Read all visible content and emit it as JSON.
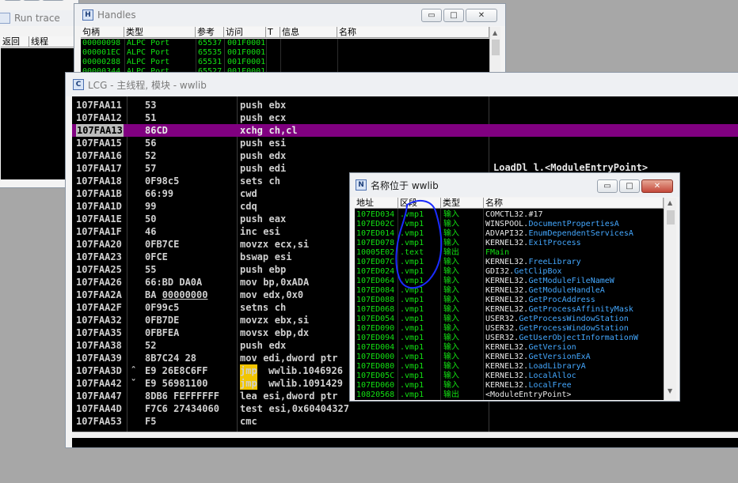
{
  "windows": {
    "run_trace": {
      "title": "Run trace",
      "headers": [
        "返回",
        "线程"
      ]
    },
    "handles": {
      "title": "Handles",
      "headers": [
        "句柄",
        "类型",
        "参考",
        "访问",
        "T",
        "信息",
        "名称"
      ],
      "rows": [
        {
          "handle": "00000098",
          "type": "ALPC Port",
          "ref": "65537",
          "access": "001F0001"
        },
        {
          "handle": "000001EC",
          "type": "ALPC Port",
          "ref": "65535",
          "access": "001F0001"
        },
        {
          "handle": "00000288",
          "type": "ALPC Port",
          "ref": "65531",
          "access": "001F0001"
        },
        {
          "handle": "00000344",
          "type": "ALPC Port",
          "ref": "65527",
          "access": "001F0001"
        }
      ]
    },
    "cpu": {
      "title": "LCG - 主线程, 模块 - wwlib",
      "side_text": "LoadDl l.<ModuleEntryPoint>",
      "rows": [
        {
          "addr": "107FAA11",
          "prefix": "",
          "hex": "53",
          "mn": "push",
          "op": "ebx",
          "style": "push"
        },
        {
          "addr": "107FAA12",
          "prefix": "",
          "hex": "51",
          "mn": "push",
          "op": "ecx",
          "style": "push"
        },
        {
          "addr": "107FAA13",
          "prefix": "",
          "hex": "86CD",
          "mn": "xchg",
          "op": "ch,cl",
          "style": "sel"
        },
        {
          "addr": "107FAA15",
          "prefix": "",
          "hex": "56",
          "mn": "push",
          "op": "esi",
          "style": "push"
        },
        {
          "addr": "107FAA16",
          "prefix": "",
          "hex": "52",
          "mn": "push",
          "op": "edx",
          "style": "push"
        },
        {
          "addr": "107FAA17",
          "prefix": "",
          "hex": "57",
          "mn": "push",
          "op": "edi",
          "style": "push"
        },
        {
          "addr": "107FAA18",
          "prefix": "",
          "hex": "0F98c5",
          "mn": "sets",
          "op": "ch",
          "style": "normal"
        },
        {
          "addr": "107FAA1B",
          "prefix": "",
          "hex": "66:99",
          "mn": "cwd",
          "op": "",
          "style": "normal"
        },
        {
          "addr": "107FAA1D",
          "prefix": "",
          "hex": "99",
          "mn": "cdq",
          "op": "",
          "style": "normal"
        },
        {
          "addr": "107FAA1E",
          "prefix": "",
          "hex": "50",
          "mn": "push",
          "op": "eax",
          "style": "push"
        },
        {
          "addr": "107FAA1F",
          "prefix": "",
          "hex": "46",
          "mn": "inc",
          "op": "esi",
          "style": "normal"
        },
        {
          "addr": "107FAA20",
          "prefix": "",
          "hex": "0FB7CE",
          "mn": "movzx",
          "op": "ecx,si",
          "style": "normal"
        },
        {
          "addr": "107FAA23",
          "prefix": "",
          "hex": "0FCE",
          "mn": "bswap",
          "op": "esi",
          "style": "normal"
        },
        {
          "addr": "107FAA25",
          "prefix": "",
          "hex": "55",
          "mn": "push",
          "op": "ebp",
          "style": "push"
        },
        {
          "addr": "107FAA26",
          "prefix": "",
          "hex": "66:BD DA0A",
          "mn": "mov",
          "op": "bp,",
          "imm": "0xADA",
          "style": "normal"
        },
        {
          "addr": "107FAA2A",
          "prefix": "",
          "hex": "BA 00000000",
          "mn": "mov",
          "op": "edx,",
          "imm": "0x0",
          "style": "normal"
        },
        {
          "addr": "107FAA2F",
          "prefix": "",
          "hex": "0F99c5",
          "mn": "setns",
          "op": "ch",
          "style": "normal"
        },
        {
          "addr": "107FAA32",
          "prefix": "",
          "hex": "0FB7DE",
          "mn": "movzx",
          "op": "ebx,si",
          "style": "normal"
        },
        {
          "addr": "107FAA35",
          "prefix": "",
          "hex": "0FBFEA",
          "mn": "movsx",
          "op": "ebp,dx",
          "style": "normal"
        },
        {
          "addr": "107FAA38",
          "prefix": "",
          "hex": "52",
          "mn": "push",
          "op": "edx",
          "style": "push"
        },
        {
          "addr": "107FAA39",
          "prefix": "",
          "hex": "8B7C24 28",
          "mn": "mov",
          "op": "edi,",
          "kw": "dword ptr",
          "style": "normal"
        },
        {
          "addr": "107FAA3D",
          "prefix": "ˆ",
          "hex": "E9 26E8C6FF",
          "mn": "jmp",
          "op": "wwlib.1046926",
          "style": "jmp"
        },
        {
          "addr": "107FAA42",
          "prefix": "ˇ",
          "hex": "E9 56981100",
          "mn": "jmp",
          "op": "wwlib.1091429",
          "style": "jmp"
        },
        {
          "addr": "107FAA47",
          "prefix": "",
          "hex": "8DB6 FEFFFFFF",
          "mn": "lea",
          "op": "esi,",
          "kw": "dword ptr",
          "style": "normal"
        },
        {
          "addr": "107FAA4D",
          "prefix": "",
          "hex": "F7C6 27434060",
          "mn": "test",
          "op": "esi,",
          "imm": "0x60404327",
          "style": "normal"
        },
        {
          "addr": "107FAA53",
          "prefix": "",
          "hex": "F5",
          "mn": "cmc",
          "op": "",
          "style": "normal"
        }
      ]
    },
    "names": {
      "title": "名称位于 wwlib",
      "headers": [
        "地址",
        "区段",
        "类型",
        "名称"
      ],
      "rows": [
        {
          "addr": "107ED034",
          "sec": ".vmp1",
          "kind": "输入",
          "mod": "COMCTL32.",
          "fn": "#17"
        },
        {
          "addr": "107ED02C",
          "sec": ".vmp1",
          "kind": "输入",
          "mod": "WINSPOOL.",
          "fn": "DocumentPropertiesA"
        },
        {
          "addr": "107ED014",
          "sec": ".vmp1",
          "kind": "输入",
          "mod": "ADVAPI32.",
          "fn": "EnumDependentServicesA"
        },
        {
          "addr": "107ED078",
          "sec": ".vmp1",
          "kind": "输入",
          "mod": "KERNEL32.",
          "fn": "ExitProcess"
        },
        {
          "addr": "10005E02",
          "sec": ".text",
          "kind": "输出",
          "mod": "",
          "fn": "FMain"
        },
        {
          "addr": "107ED07C",
          "sec": ".vmp1",
          "kind": "输入",
          "mod": "KERNEL32.",
          "fn": "FreeLibrary"
        },
        {
          "addr": "107ED024",
          "sec": ".vmp1",
          "kind": "输入",
          "mod": "GDI32.",
          "fn": "GetClipBox"
        },
        {
          "addr": "107ED064",
          "sec": ".vmp1",
          "kind": "输入",
          "mod": "KERNEL32.",
          "fn": "GetModuleFileNameW"
        },
        {
          "addr": "107ED084",
          "sec": ".vmp1",
          "kind": "输入",
          "mod": "KERNEL32.",
          "fn": "GetModuleHandleA"
        },
        {
          "addr": "107ED088",
          "sec": ".vmp1",
          "kind": "输入",
          "mod": "KERNEL32.",
          "fn": "GetProcAddress"
        },
        {
          "addr": "107ED068",
          "sec": ".vmp1",
          "kind": "输入",
          "mod": "KERNEL32.",
          "fn": "GetProcessAffinityMask"
        },
        {
          "addr": "107ED054",
          "sec": ".vmp1",
          "kind": "输入",
          "mod": "USER32.",
          "fn": "GetProcessWindowStation"
        },
        {
          "addr": "107ED090",
          "sec": ".vmp1",
          "kind": "输入",
          "mod": "USER32.",
          "fn": "GetProcessWindowStation"
        },
        {
          "addr": "107ED094",
          "sec": ".vmp1",
          "kind": "输入",
          "mod": "USER32.",
          "fn": "GetUserObjectInformationW"
        },
        {
          "addr": "107ED004",
          "sec": ".vmp1",
          "kind": "输入",
          "mod": "KERNEL32.",
          "fn": "GetVersion"
        },
        {
          "addr": "107ED000",
          "sec": ".vmp1",
          "kind": "输入",
          "mod": "KERNEL32.",
          "fn": "GetVersionExA"
        },
        {
          "addr": "107ED080",
          "sec": ".vmp1",
          "kind": "输入",
          "mod": "KERNEL32.",
          "fn": "LoadLibraryA"
        },
        {
          "addr": "107ED05C",
          "sec": ".vmp1",
          "kind": "输入",
          "mod": "KERNEL32.",
          "fn": "LocalAlloc"
        },
        {
          "addr": "107ED060",
          "sec": ".vmp1",
          "kind": "输入",
          "mod": "KERNEL32.",
          "fn": "LocalFree"
        },
        {
          "addr": "10820568",
          "sec": ".vmp1",
          "kind": "输出",
          "mod": "",
          "fn": "<ModuleEntryPoint>"
        }
      ]
    }
  },
  "controls": {
    "minimize": "▭",
    "maximize": "□",
    "close": "✕"
  },
  "colors": {
    "push": "#2a35ff",
    "selected_row": "#800080",
    "jmp_bg": "#f2c500",
    "names_green": "#12e012",
    "names_func": "#44a8ff",
    "annotation": "#1a2cff"
  }
}
